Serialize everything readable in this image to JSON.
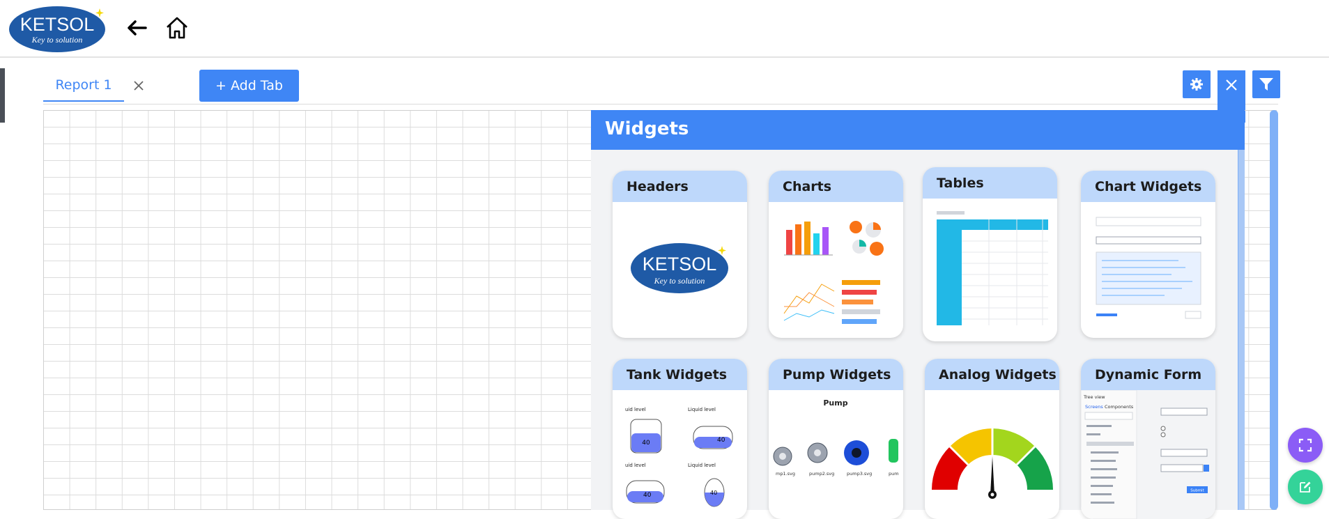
{
  "app": {
    "logo_text": "KETSOL",
    "logo_tagline": "Key to solution"
  },
  "tabs": [
    {
      "label": "Report 1",
      "active": true
    }
  ],
  "add_tab_label": "+ Add Tab",
  "panel": {
    "title": "Widgets",
    "cards": [
      {
        "title": "Headers"
      },
      {
        "title": "Charts"
      },
      {
        "title": "Tables"
      },
      {
        "title": "Chart Widgets"
      },
      {
        "title": "Tank Widgets"
      },
      {
        "title": "Pump Widgets"
      },
      {
        "title": "Analog Widgets"
      },
      {
        "title": "Dynamic Form"
      }
    ]
  },
  "previews": {
    "tank_label": "Liquid level",
    "tank_label_short": "uid level",
    "tank_value": "40",
    "tank_unit": "%",
    "pump_title": "Pump",
    "pump_files": [
      "mp1.svg",
      "pump2.svg",
      "pump3.svg",
      "pum"
    ],
    "form_tree_title": "Tree view",
    "form_tabs": [
      "Screens",
      "Components"
    ],
    "form_submit": "Submit"
  },
  "colors": {
    "accent": "#3f86f5",
    "card_header": "#bed8fb",
    "fab_purple": "#8b5cf6",
    "fab_green": "#34d399",
    "logo_blue": "#1f5aa6"
  }
}
